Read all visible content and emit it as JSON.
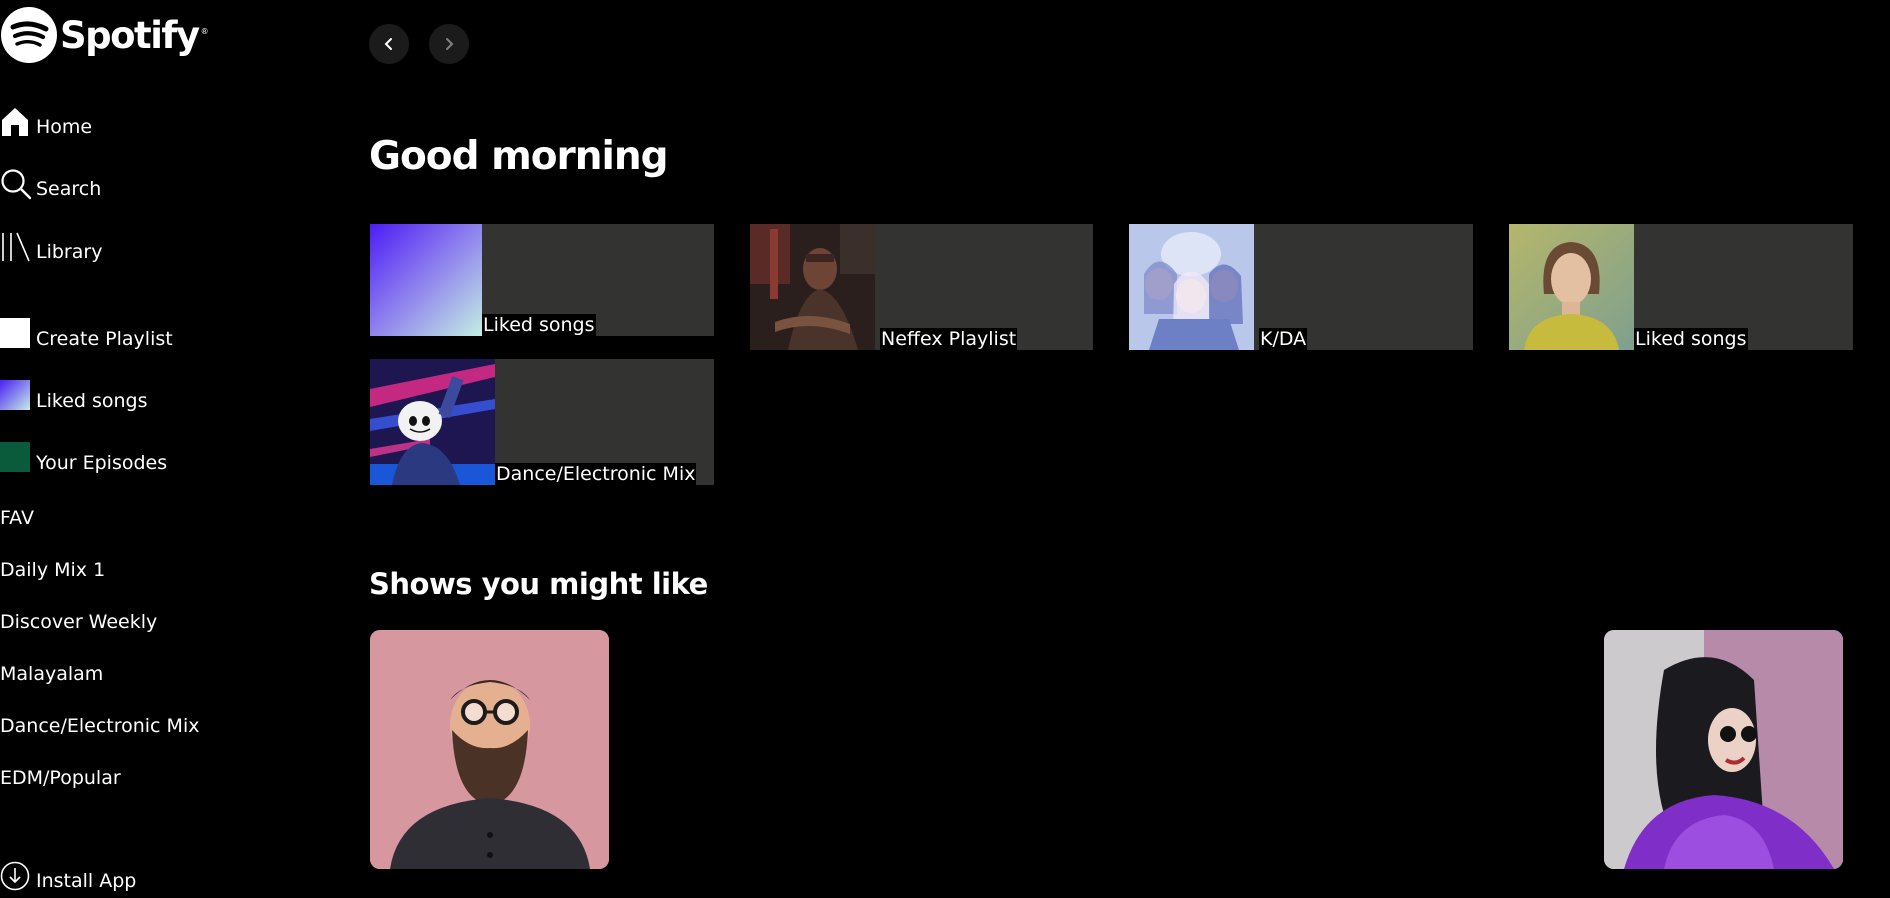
{
  "app": {
    "name": "Spotify",
    "registered_mark": "®"
  },
  "sidebar": {
    "nav": [
      {
        "label": "Home",
        "icon": "home-icon"
      },
      {
        "label": "Search",
        "icon": "search-icon"
      },
      {
        "label": "Library",
        "icon": "library-icon"
      }
    ],
    "actions": [
      {
        "label": "Create Playlist",
        "icon": "create-playlist-icon"
      },
      {
        "label": "Liked songs",
        "icon": "liked-songs-icon"
      },
      {
        "label": "Your Episodes",
        "icon": "episodes-icon"
      }
    ],
    "playlists": [
      "FAV",
      "Daily Mix 1",
      "Discover Weekly",
      "Malayalam",
      "Dance/Electronic Mix",
      "EDM/Popular"
    ],
    "install": {
      "label": "Install App",
      "icon": "download-circle-icon"
    }
  },
  "navigation": {
    "back_icon": "chevron-left-icon",
    "forward_icon": "chevron-right-icon"
  },
  "main": {
    "greeting": "Good morning",
    "quick_picks": [
      {
        "title": "Liked songs"
      },
      {
        "title": "Neffex Playlist"
      },
      {
        "title": "K/DA"
      },
      {
        "title": "Liked songs"
      },
      {
        "title": "Dance/Electronic Mix"
      }
    ],
    "shows_heading": "Shows you might like"
  },
  "colors": {
    "background": "#000000",
    "card": "#333432",
    "liked_gradient_start": "#4b1df5",
    "liked_gradient_end": "#c4eee3",
    "episodes": "#0a5a3c"
  }
}
